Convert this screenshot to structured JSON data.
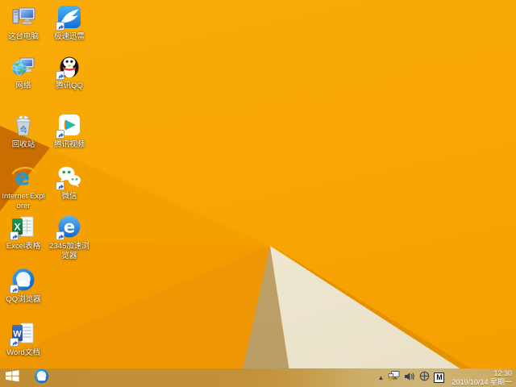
{
  "desktop": {
    "icons": [
      {
        "label": "这台电脑",
        "name": "this-pc",
        "shortcut": false
      },
      {
        "label": "极速迅雷",
        "name": "xunlei",
        "shortcut": true
      },
      {
        "label": "网络",
        "name": "network",
        "shortcut": false
      },
      {
        "label": "腾讯QQ",
        "name": "tencent-qq",
        "shortcut": true
      },
      {
        "label": "回收站",
        "name": "recycle-bin",
        "shortcut": false
      },
      {
        "label": "腾讯视频",
        "name": "tencent-video",
        "shortcut": true
      },
      {
        "label": "Internet Explorer",
        "name": "internet-explorer",
        "shortcut": false
      },
      {
        "label": "微信",
        "name": "wechat",
        "shortcut": true
      },
      {
        "label": "Excel表格",
        "name": "excel",
        "shortcut": true
      },
      {
        "label": "2345加速浏览器",
        "name": "browser-2345",
        "shortcut": true
      },
      {
        "label": "QQ浏览器",
        "name": "qq-browser",
        "shortcut": true
      },
      {
        "label": "Word文档",
        "name": "word",
        "shortcut": true
      }
    ]
  },
  "taskbar": {
    "tray": {
      "hidden_icons_glyph": "▲",
      "ime_label": "M"
    },
    "clock": {
      "time": "12:30",
      "date": "2019/10/14 星期一"
    }
  },
  "colors": {
    "wallpaper_orange": "#f7a503",
    "wallpaper_orange_dark": "#ee9604",
    "wallpaper_burnt": "#c96e00",
    "wallpaper_tan": "#bfa164",
    "wallpaper_cream": "#f1ead7",
    "wallpaper_stripe": "#e59200",
    "taskbar_tint_left": "#c18d34",
    "taskbar_tint_right": "#cfb577",
    "label_text": "#ffffff"
  }
}
